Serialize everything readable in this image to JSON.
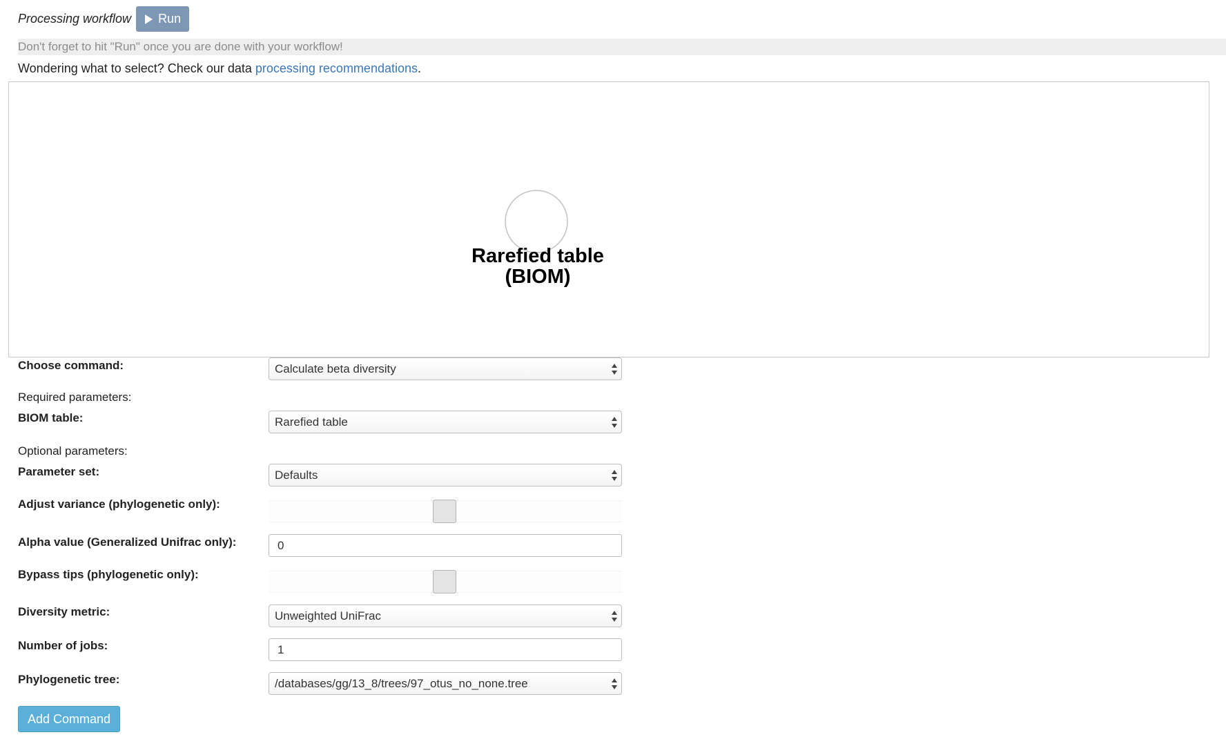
{
  "header": {
    "title": "Processing workflow",
    "run_label": "Run",
    "run_icon": "play-icon"
  },
  "notice": "Don't forget to hit \"Run\" once you are done with your workflow!",
  "wondering": {
    "prefix": "Wondering what to select? Check our data ",
    "link_text": "processing recommendations",
    "suffix": "."
  },
  "graph": {
    "node": {
      "label_line1": "Rarefied table",
      "label_line2": "(BIOM)"
    }
  },
  "form": {
    "choose_command": {
      "label": "Choose command:",
      "value": "Calculate beta diversity"
    },
    "required_heading": "Required parameters:",
    "biom_table": {
      "label": "BIOM table:",
      "value": "Rarefied table"
    },
    "optional_heading": "Optional parameters:",
    "parameter_set": {
      "label": "Parameter set:",
      "value": "Defaults"
    },
    "adjust_variance": {
      "label": "Adjust variance (phylogenetic only):"
    },
    "alpha_value": {
      "label": "Alpha value (Generalized Unifrac only):",
      "value": "0"
    },
    "bypass_tips": {
      "label": "Bypass tips (phylogenetic only):"
    },
    "diversity_metric": {
      "label": "Diversity metric:",
      "value": "Unweighted UniFrac"
    },
    "number_of_jobs": {
      "label": "Number of jobs:",
      "value": "1"
    },
    "phylogenetic_tree": {
      "label": "Phylogenetic tree:",
      "value": "/databases/gg/13_8/trees/97_otus_no_none.tree"
    },
    "add_command_label": "Add Command"
  },
  "colors": {
    "run_button": "#7e97b4",
    "link": "#3a77b8",
    "add_command_button": "#5ab0d8",
    "notice_bg": "#eeeeee"
  }
}
